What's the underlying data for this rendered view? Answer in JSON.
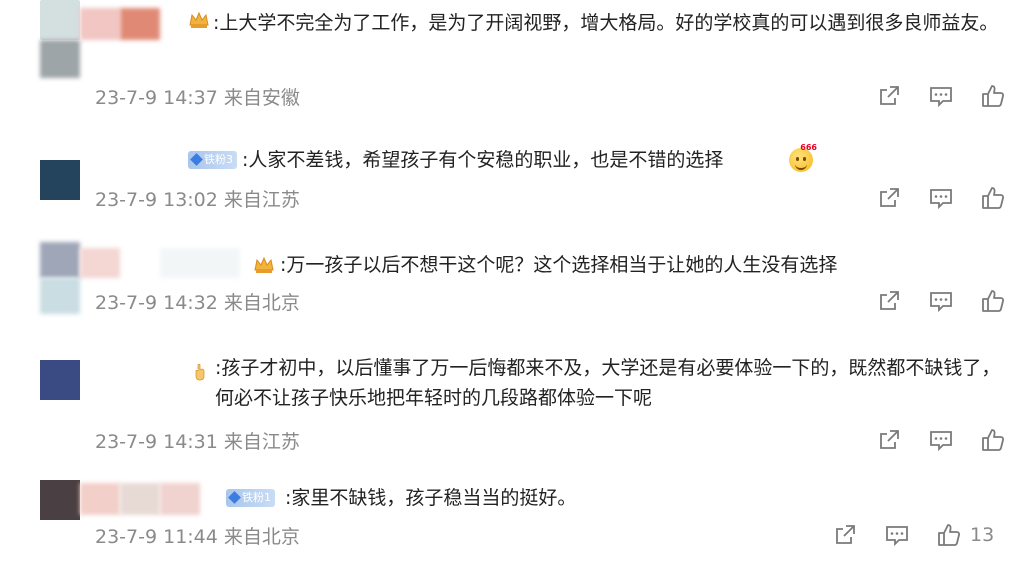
{
  "comments": [
    {
      "text": ":上大学不完全为了工作，是为了开阔视野，增大格局。好的学校真的可以遇到很多良师益友。",
      "time": "23-7-9 14:37 来自安徽",
      "likes": ""
    },
    {
      "badge": "铁粉3",
      "text": ":人家不差钱，希望孩子有个安稳的职业，也是不错的选择",
      "emoji_tag": "666",
      "time": "23-7-9 13:02 来自江苏",
      "likes": ""
    },
    {
      "text": ":万一孩子以后不想干这个呢？这个选择相当于让她的人生没有选择",
      "time": "23-7-9 14:32 来自北京",
      "likes": ""
    },
    {
      "text": ":孩子才初中，以后懂事了万一后悔都来不及，大学还是有必要体验一下的，既然都不缺钱了，何必不让孩子快乐地把年轻时的几段路都体验一下呢",
      "time": "23-7-9 14:31 来自江苏",
      "likes": ""
    },
    {
      "badge": "铁粉1",
      "text": ":家里不缺钱，孩子稳当当的挺好。",
      "time": "23-7-9 11:44 来自北京",
      "likes": "13"
    }
  ],
  "icons": {
    "share": "share-icon",
    "comment": "comment-icon",
    "like": "thumbs-up-icon"
  },
  "colors": {
    "text": "#222222",
    "meta": "#8a8a8a",
    "icon": "#7a7a7a",
    "badge": "#a9c6ec"
  }
}
